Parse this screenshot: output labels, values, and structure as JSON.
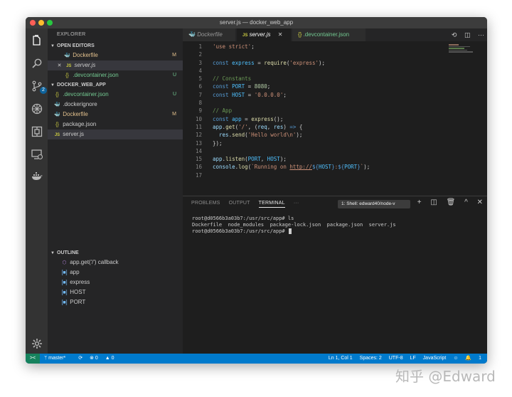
{
  "window": {
    "title": "server.js — docker_web_app"
  },
  "sidebar": {
    "title": "EXPLORER",
    "open_editors": {
      "label": "OPEN EDITORS",
      "items": [
        {
          "name": "Dockerfile",
          "status": "M"
        },
        {
          "name": "server.js",
          "status": ""
        },
        {
          "name": ".devcontainer.json",
          "status": "U"
        }
      ]
    },
    "folder": {
      "label": "DOCKER_WEB_APP",
      "items": [
        {
          "name": ".devcontainer.json",
          "status": "U"
        },
        {
          "name": ".dockerignore",
          "status": ""
        },
        {
          "name": "Dockerfile",
          "status": "M"
        },
        {
          "name": "package.json",
          "status": ""
        },
        {
          "name": "server.js",
          "status": ""
        }
      ]
    },
    "outline": {
      "label": "OUTLINE",
      "items": [
        "app.get('/') callback",
        "app",
        "express",
        "HOST",
        "PORT"
      ]
    }
  },
  "activity": {
    "scm_badge": "2"
  },
  "tabs": [
    {
      "label": "Dockerfile"
    },
    {
      "label": "server.js"
    },
    {
      "label": ".devcontainer.json"
    }
  ],
  "panel": {
    "tabs": [
      "PROBLEMS",
      "OUTPUT",
      "TERMINAL",
      "···"
    ],
    "shell": "1: Shell: edward40/node-v",
    "terminal": [
      "root@d0566b3a03b7:/usr/src/app# ls",
      "Dockerfile  node_modules  package-lock.json  package.json  server.js",
      "root@d0566b3a03b7:/usr/src/app# "
    ]
  },
  "statusbar": {
    "remote": "><",
    "branch": "master*",
    "sync": "⟳",
    "errors": "⊗ 0",
    "warnings": "▲ 0",
    "position": "Ln 1, Col 1",
    "spaces": "Spaces: 2",
    "encoding": "UTF-8",
    "eol": "LF",
    "language": "JavaScript",
    "feedback": "☺",
    "notifications": "1"
  },
  "watermark": "知乎 @Edward"
}
